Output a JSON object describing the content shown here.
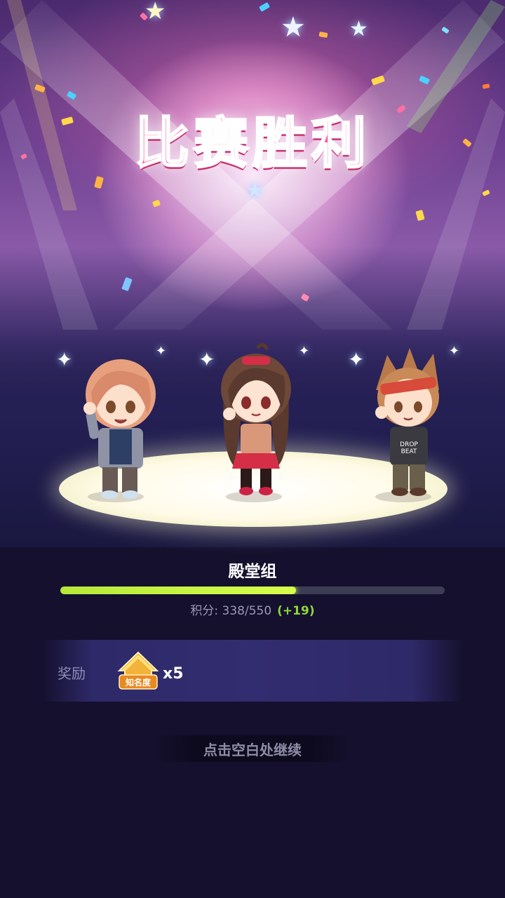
{
  "title": "比赛胜利",
  "group": {
    "name": "殿堂组",
    "progress": 0.614
  },
  "score": {
    "label": "积分: 338/550",
    "gain": "(+19)"
  },
  "reward": {
    "label": "奖励",
    "item_name": "知名度",
    "item_icon": "fame-house-icon",
    "count": "x5"
  },
  "continue_hint": "点击空白处继续",
  "characters": [
    {
      "name": "character-left-boy",
      "icon": "pink-hair-boy"
    },
    {
      "name": "character-center-girl",
      "icon": "brown-hair-girl"
    },
    {
      "name": "character-right-boy",
      "icon": "headband-boy"
    }
  ],
  "colors": {
    "title": "#ff5ba8",
    "progress_fill": "#c8ff4a",
    "score_gain": "#8ed63b",
    "background": "#15102e"
  }
}
